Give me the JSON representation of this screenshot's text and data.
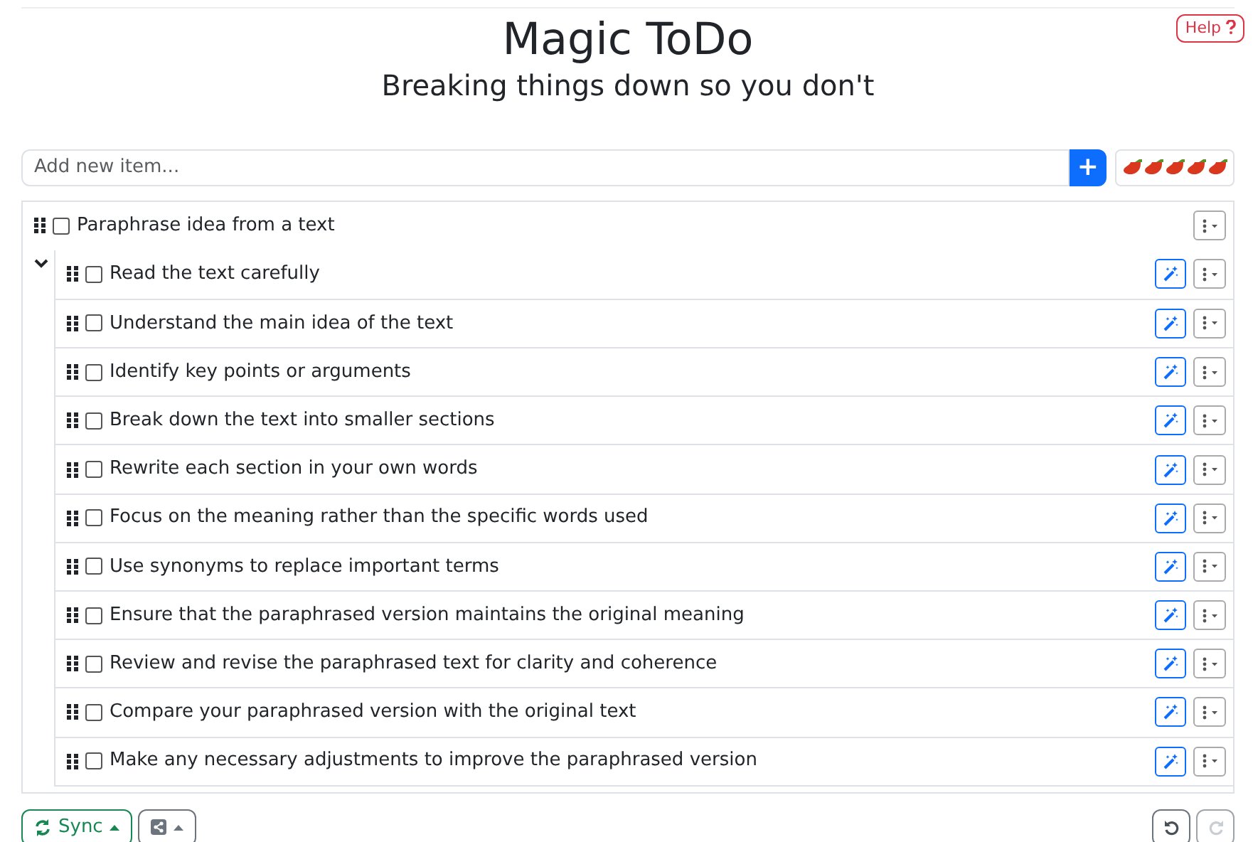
{
  "header": {
    "title": "Magic ToDo",
    "subtitle": "Breaking things down so you don't",
    "help": "Help"
  },
  "new_item": {
    "placeholder": "Add new item...",
    "add_button": "+"
  },
  "spiciness": {
    "stars": 5
  },
  "task": {
    "label": "Paraphrase idea from a text",
    "checked": false,
    "expanded": true,
    "children": [
      {
        "label": "Read the text carefully",
        "checked": false
      },
      {
        "label": "Understand the main idea of the text",
        "checked": false
      },
      {
        "label": "Identify key points or arguments",
        "checked": false
      },
      {
        "label": "Break down the text into smaller sections",
        "checked": false
      },
      {
        "label": "Rewrite each section in your own words",
        "checked": false
      },
      {
        "label": "Focus on the meaning rather than the specific words used",
        "checked": false
      },
      {
        "label": "Use synonyms to replace important terms",
        "checked": false
      },
      {
        "label": "Ensure that the paraphrased version maintains the original meaning",
        "checked": false
      },
      {
        "label": "Review and revise the paraphrased text for clarity and coherence",
        "checked": false
      },
      {
        "label": "Compare your paraphrased version with the original text",
        "checked": false
      },
      {
        "label": "Make any necessary adjustments to improve the paraphrased version",
        "checked": false
      }
    ]
  },
  "footer": {
    "sync": "Sync",
    "undo_disabled": false,
    "redo_disabled": true
  }
}
